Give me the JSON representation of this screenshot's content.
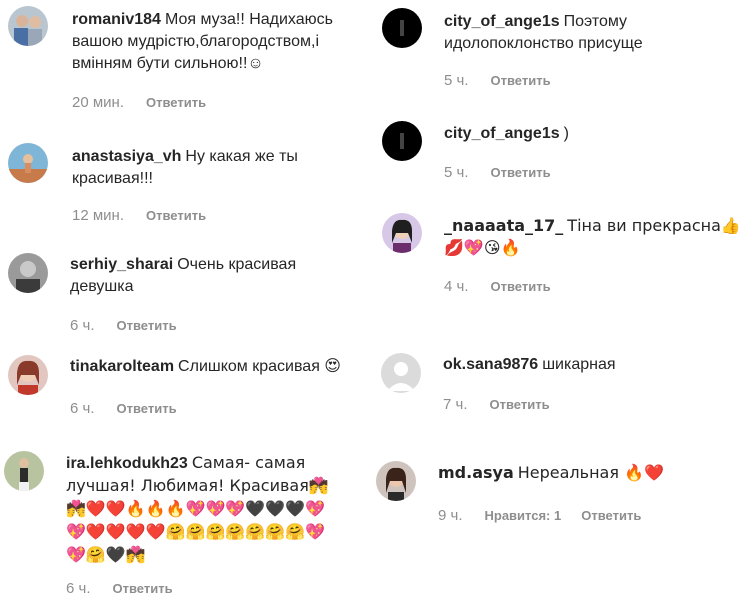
{
  "reply_label": "Ответить",
  "left_comments": [
    {
      "username": "romaniv184",
      "text": "Моя муза!! Надихаюсь вашою мудрістю,благородством,і вмінням бути сильною!!☺",
      "time": "20 мин."
    },
    {
      "username": "anastasiya_vh",
      "text": "Ну какая же ты красивая!!!",
      "time": "12 мин."
    },
    {
      "username": "serhiy_sharai",
      "text": "Очень красивая девушка",
      "time": "6 ч."
    },
    {
      "username": "tinakarolteam",
      "text": "Слишком красивая 😍",
      "time": "6 ч."
    },
    {
      "username": "ira.lehkodukh23",
      "text": "Самая- самая лучшая! Любимая! Красивая💏💏❤️❤️🔥🔥🔥💖💖💖🖤🖤🖤💖💖❤️❤️❤️❤️🤗🤗🤗🤗🤗🤗🤗💖💖🤗🖤💏",
      "time": "6 ч."
    }
  ],
  "right_comments": [
    {
      "username": "city_of_ange1s",
      "text": "Поэтому идолопоклонство присуще",
      "time": "5 ч."
    },
    {
      "username": "city_of_ange1s",
      "text": ")",
      "time": "5 ч."
    },
    {
      "username": "_naaaata_17_",
      "text": "Тіна ви прекрасна👍💋💖😘🔥",
      "time": "4 ч."
    },
    {
      "username": "ok.sana9876",
      "text": "шикарная",
      "time": "7 ч."
    },
    {
      "username": "md.asya",
      "text": "Нереальная 🔥❤️",
      "time": "9 ч.",
      "likes": "Нравится: 1"
    }
  ],
  "colors": {
    "text": "#262626",
    "muted": "#8e8e8e",
    "background": "#ffffff"
  }
}
